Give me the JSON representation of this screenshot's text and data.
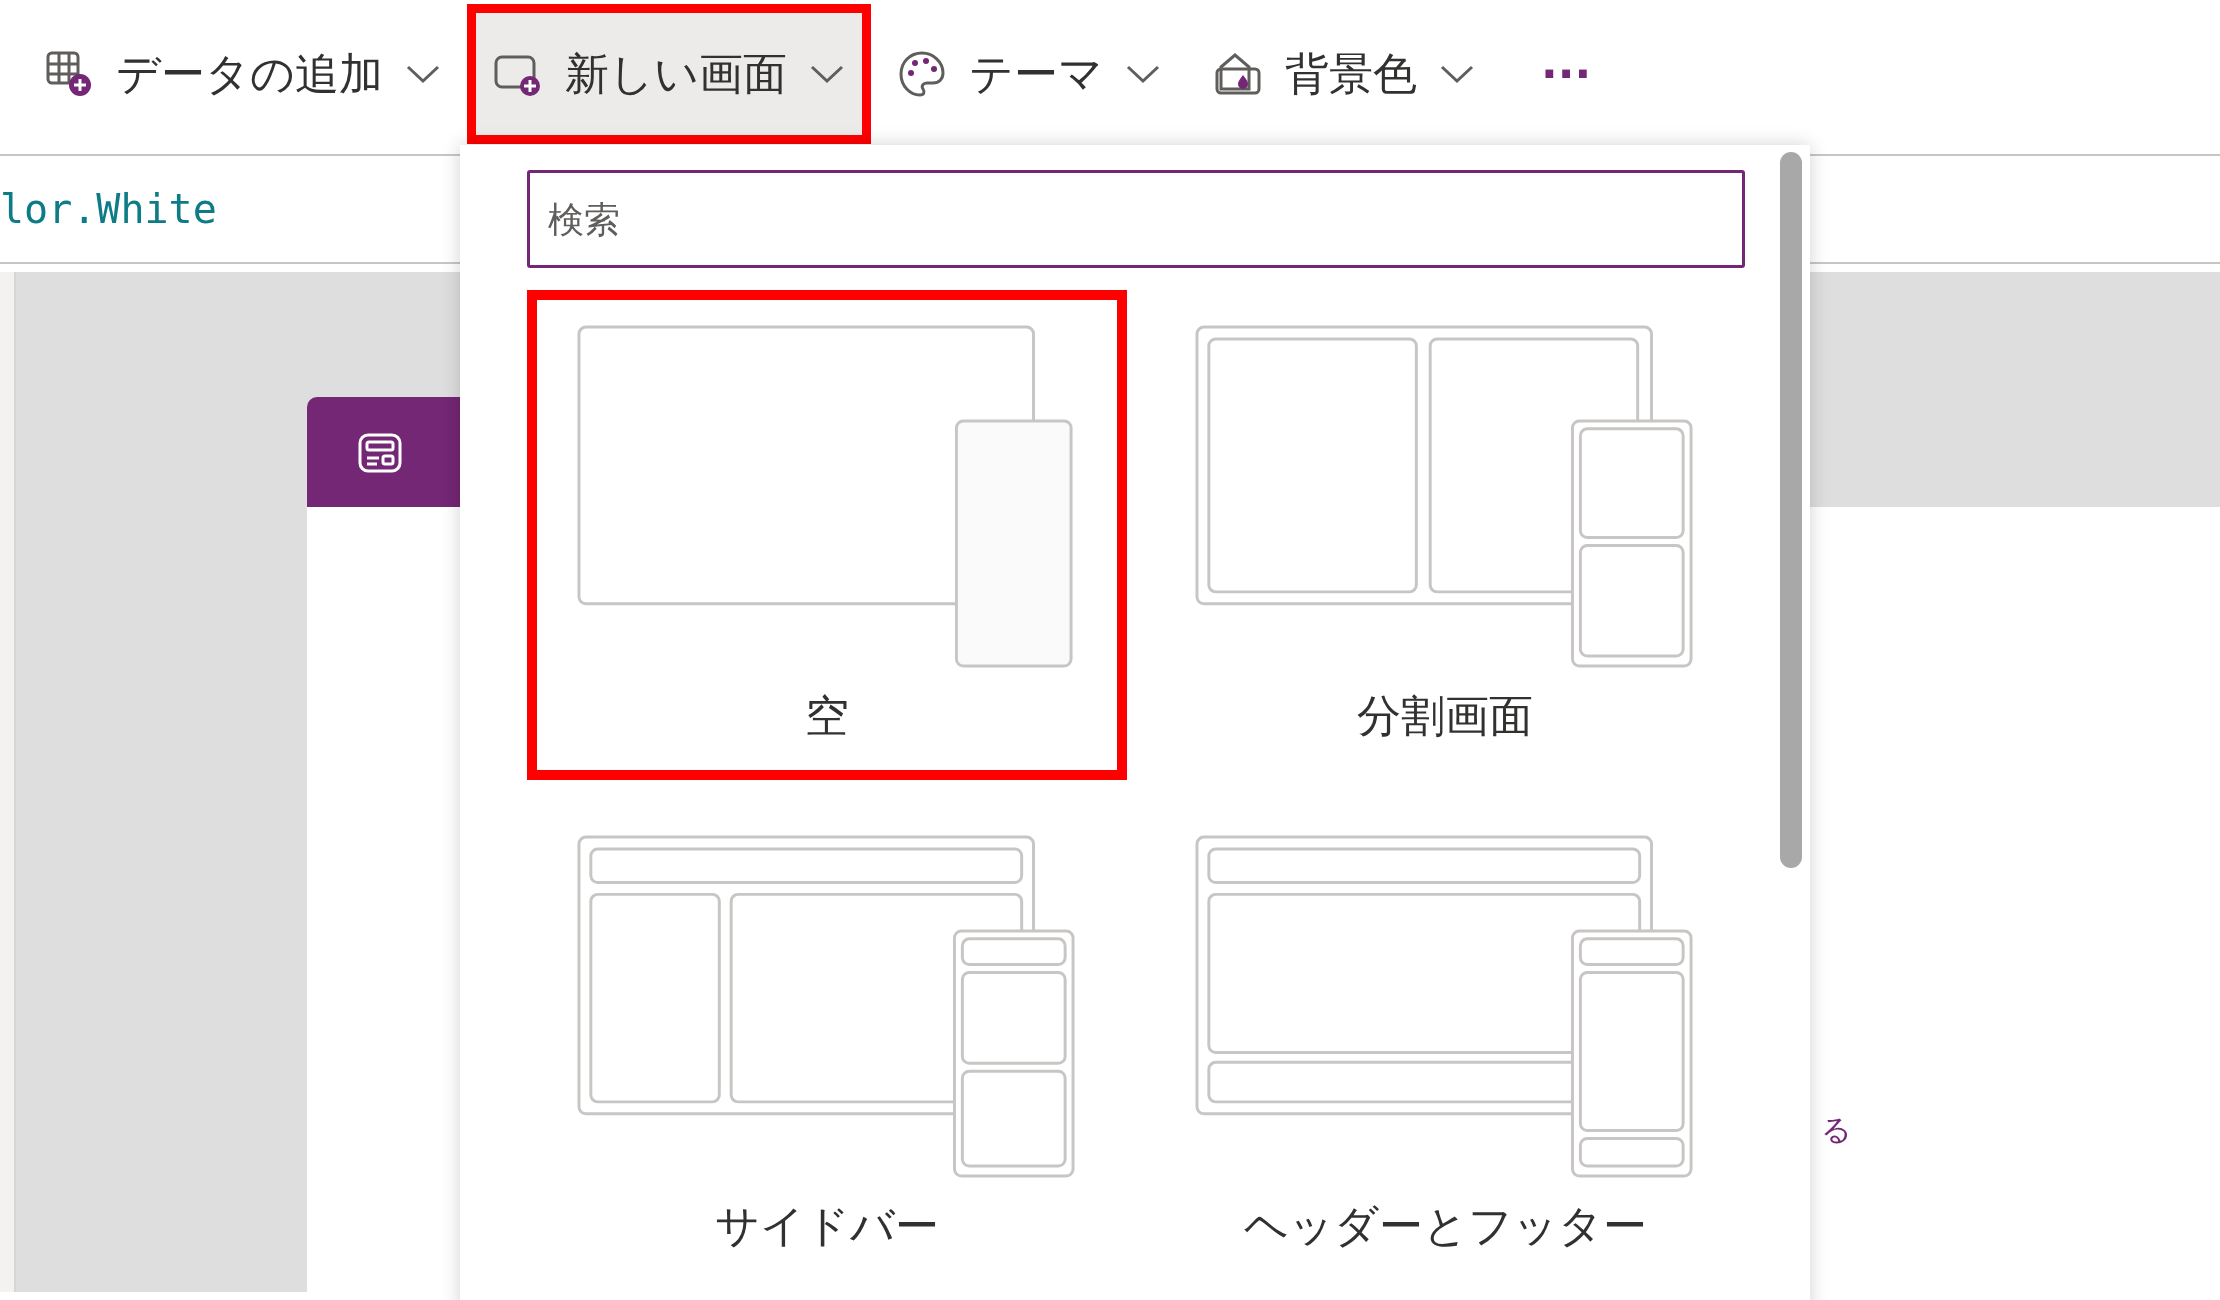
{
  "toolbar": {
    "items": [
      {
        "kind": "data",
        "label": "データの追加",
        "expanded": false,
        "highlighted": false
      },
      {
        "kind": "screen",
        "label": "新しい画面",
        "expanded": true,
        "highlighted": true
      },
      {
        "kind": "theme",
        "label": "テーマ",
        "expanded": false,
        "highlighted": false
      },
      {
        "kind": "background",
        "label": "背景色",
        "expanded": false,
        "highlighted": false
      }
    ],
    "more": "···"
  },
  "formula_bar": {
    "text": "lor.White"
  },
  "canvas": {
    "side_text": "る"
  },
  "new_screen_menu": {
    "search": {
      "placeholder": "検索"
    },
    "layouts": [
      {
        "kind": "blank",
        "label": "空",
        "highlighted": true
      },
      {
        "kind": "split",
        "label": "分割画面",
        "highlighted": false
      },
      {
        "kind": "sidebar",
        "label": "サイドバー",
        "highlighted": false
      },
      {
        "kind": "header_footer",
        "label": "ヘッダーとフッター",
        "highlighted": false
      }
    ]
  }
}
